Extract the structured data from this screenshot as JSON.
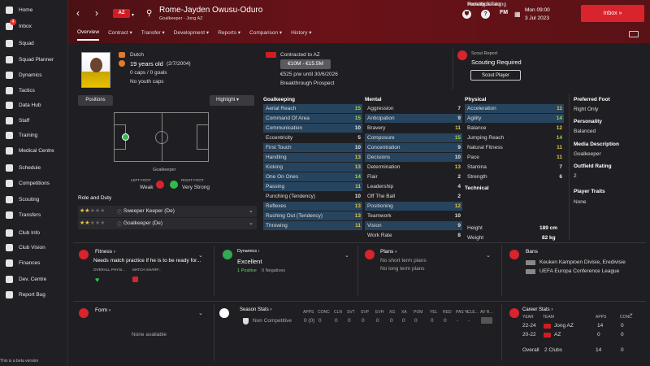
{
  "sidebar": {
    "items": [
      {
        "label": "Home",
        "icon": "home-icon"
      },
      {
        "label": "Inbox",
        "icon": "inbox-icon",
        "badge": "4"
      },
      {
        "label": "Squad",
        "icon": "squad-icon"
      },
      {
        "label": "Squad Planner",
        "icon": "planner-icon"
      },
      {
        "label": "Dynamics",
        "icon": "dynamics-icon"
      },
      {
        "label": "Tactics",
        "icon": "tactics-icon"
      },
      {
        "label": "Data Hub",
        "icon": "data-hub-icon"
      },
      {
        "label": "Staff",
        "icon": "staff-icon"
      },
      {
        "label": "Training",
        "icon": "training-icon"
      },
      {
        "label": "Medical Centre",
        "icon": "medical-icon"
      },
      {
        "label": "Schedule",
        "icon": "schedule-icon"
      },
      {
        "label": "Competitions",
        "icon": "trophy-icon"
      },
      {
        "label": "Scouting",
        "icon": "scouting-icon"
      },
      {
        "label": "Transfers",
        "icon": "transfers-icon"
      },
      {
        "label": "Club Info",
        "icon": "club-info-icon"
      },
      {
        "label": "Club Vision",
        "icon": "vision-icon"
      },
      {
        "label": "Finances",
        "icon": "finances-icon"
      },
      {
        "label": "Dev. Centre",
        "icon": "dev-centre-icon"
      },
      {
        "label": "Report Bug",
        "icon": "bug-icon"
      }
    ],
    "beta": "This is a beta version"
  },
  "header": {
    "club_badge": "AZ",
    "player_name": "Rome-Jayden Owusu-Oduro",
    "position_club": "Goalkeeper - Jong AZ",
    "help": "?",
    "fm": "FM",
    "day_time": "Mon 09:00",
    "date": "3 Jul 2023",
    "inbox": "Inbox  »"
  },
  "tabs": [
    "Overview",
    "Contract",
    "Transfer",
    "Development",
    "Reports",
    "Comparison",
    "History"
  ],
  "profile": {
    "nationality": "Dutch",
    "age": "19 years old",
    "dob": "(2/7/2004)",
    "caps": "0 caps / 0 goals",
    "youth_caps": "No youth caps",
    "contracted": "Contracted to AZ",
    "value": "€10M - €15.5M",
    "wage": "€525 p/w until 30/6/2026",
    "status": "Breakthrough Prospect",
    "scout_title": "Scout Report",
    "scout_status": "Scouting Required",
    "scout_button": "Scout Player"
  },
  "positions": {
    "button": "Positions",
    "highlight": "Highlight",
    "pitch_label": "Goalkeeper",
    "left_foot_label": "LEFT FOOT",
    "right_foot_label": "RIGHT FOOT",
    "left_foot": "Weak",
    "right_foot": "Very Strong"
  },
  "roles": {
    "title": "Role and Duty",
    "rows": [
      {
        "name": "Sweeper Keeper (De)",
        "stars": 2
      },
      {
        "name": "Goalkeeper (De)",
        "stars": 2
      }
    ]
  },
  "attributes": {
    "goalkeeping_title": "Goalkeeping",
    "goalkeeping": [
      {
        "name": "Aerial Reach",
        "value": "15",
        "hl": true
      },
      {
        "name": "Command Of Area",
        "value": "15",
        "hl": true
      },
      {
        "name": "Communication",
        "value": "10",
        "hl": true
      },
      {
        "name": "Eccentricity",
        "value": "5",
        "hl": false
      },
      {
        "name": "First Touch",
        "value": "10",
        "hl": true
      },
      {
        "name": "Handling",
        "value": "13",
        "hl": true
      },
      {
        "name": "Kicking",
        "value": "13",
        "hl": true
      },
      {
        "name": "One On Ones",
        "value": "14",
        "hl": true
      },
      {
        "name": "Passing",
        "value": "11",
        "hl": true
      },
      {
        "name": "Punching (Tendency)",
        "value": "10",
        "hl": false
      },
      {
        "name": "Reflexes",
        "value": "13",
        "hl": true
      },
      {
        "name": "Rushing Out (Tendency)",
        "value": "13",
        "hl": true
      },
      {
        "name": "Throwing",
        "value": "11",
        "hl": true
      }
    ],
    "mental_title": "Mental",
    "mental": [
      {
        "name": "Aggression",
        "value": "7",
        "hl": false
      },
      {
        "name": "Anticipation",
        "value": "9",
        "hl": true
      },
      {
        "name": "Bravery",
        "value": "11",
        "hl": false
      },
      {
        "name": "Composure",
        "value": "15",
        "hl": true
      },
      {
        "name": "Concentration",
        "value": "9",
        "hl": true
      },
      {
        "name": "Decisions",
        "value": "10",
        "hl": true
      },
      {
        "name": "Determination",
        "value": "13",
        "hl": false
      },
      {
        "name": "Flair",
        "value": "2",
        "hl": false
      },
      {
        "name": "Leadership",
        "value": "4",
        "hl": false
      },
      {
        "name": "Off The Ball",
        "value": "2",
        "hl": false
      },
      {
        "name": "Positioning",
        "value": "12",
        "hl": true
      },
      {
        "name": "Teamwork",
        "value": "10",
        "hl": false
      },
      {
        "name": "Vision",
        "value": "9",
        "hl": true
      },
      {
        "name": "Work Rate",
        "value": "8",
        "hl": false
      }
    ],
    "physical_title": "Physical",
    "physical": [
      {
        "name": "Acceleration",
        "value": "11",
        "hl": true
      },
      {
        "name": "Agility",
        "value": "14",
        "hl": true
      },
      {
        "name": "Balance",
        "value": "12",
        "hl": false
      },
      {
        "name": "Jumping Reach",
        "value": "14",
        "hl": false
      },
      {
        "name": "Natural Fitness",
        "value": "11",
        "hl": false
      },
      {
        "name": "Pace",
        "value": "11",
        "hl": false
      },
      {
        "name": "Stamina",
        "value": "7",
        "hl": false
      },
      {
        "name": "Strength",
        "value": "6",
        "hl": false
      }
    ],
    "technical_title": "Technical",
    "technical": [
      {
        "name": "Free Kick Taking",
        "value": "4",
        "hl": false
      },
      {
        "name": "Penalty Taking",
        "value": "4",
        "hl": false
      },
      {
        "name": "Technique",
        "value": "7",
        "hl": false
      }
    ],
    "height_label": "Height",
    "height": "189 cm",
    "weight_label": "Weight",
    "weight": "82 kg"
  },
  "info_panel": {
    "preferred_foot_label": "Preferred Foot",
    "preferred_foot": "Right Only",
    "personality_label": "Personality",
    "personality": "Balanced",
    "media_label": "Media Description",
    "media": "Goalkeeper",
    "outfield_label": "Outfield Rating",
    "outfield": "2",
    "traits_label": "Player Traits",
    "traits": "None"
  },
  "fitness": {
    "title": "Fitness",
    "text": "Needs match practice if he is to be ready for...",
    "col1": "OVERALL PHYSI...",
    "col2": "MATCH SHARP..."
  },
  "dynamics": {
    "title": "Dynamics",
    "status": "Excellent",
    "positive": "1 Positive",
    "negative": "0 Negatives"
  },
  "plans": {
    "title": "Plans",
    "short": "No short term plans",
    "long": "No long term plans"
  },
  "bans": {
    "title": "Bans",
    "items": [
      "Keuken Kampioen Divisie, Eredivisie",
      "UEFA Europa Conference League"
    ]
  },
  "form": {
    "title": "Form",
    "empty": "None available"
  },
  "season_stats": {
    "title": "Season Stats",
    "headers": [
      "APPS",
      "CONC",
      "CLN",
      "SVT",
      "SVP",
      "EVH",
      "XG",
      "XA",
      "POM",
      "YEL",
      "RED",
      "PAS %",
      "CLE...",
      "AV R..."
    ],
    "row_label": "Non Competitive",
    "row": [
      "0 (0)",
      "0",
      "0",
      "0",
      "0",
      "0",
      "0",
      "0",
      "0",
      "0",
      "0",
      "-",
      "-",
      "-"
    ]
  },
  "career": {
    "title": "Career Stats",
    "col_year": "YEAR",
    "col_team": "TEAM",
    "col_apps": "APPS",
    "col_conc": "CONC",
    "rows": [
      {
        "year": "22-24",
        "team": "Jong AZ",
        "apps": "14",
        "conc": "0"
      },
      {
        "year": "20-22",
        "team": "AZ",
        "apps": "0",
        "conc": "0"
      }
    ],
    "overall_label": "Overall",
    "overall_team": "2 Clubs",
    "overall_apps": "14",
    "overall_conc": "0"
  },
  "colors": {
    "accent": "#d9232d",
    "header": "#6a1218",
    "highlight_row": "#27445e",
    "attr_green": "#a3d448",
    "attr_yellow": "#e3c849",
    "attr_white": "#e0e0e0"
  }
}
